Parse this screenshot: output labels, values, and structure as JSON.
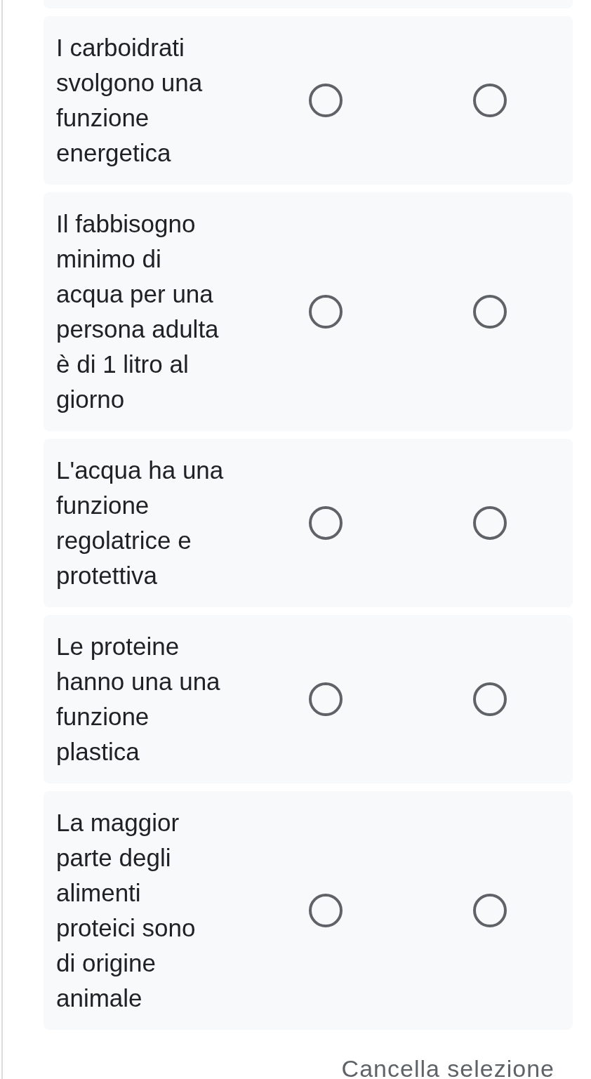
{
  "statements": [
    {
      "text": "I carboidrati\nsvolgono una\nfunzione\nenergetica",
      "choices": [
        {
          "selected": false
        },
        {
          "selected": false
        }
      ]
    },
    {
      "text": "Il fabbisogno\nminimo di\nacqua per una\npersona adulta\nè di 1 litro al\ngiorno",
      "choices": [
        {
          "selected": false
        },
        {
          "selected": false
        }
      ]
    },
    {
      "text": "L'acqua ha una\nfunzione\nregolatrice e\nprotettiva",
      "choices": [
        {
          "selected": false
        },
        {
          "selected": false
        }
      ]
    },
    {
      "text": "Le proteine\nhanno una una\nfunzione\nplastica",
      "choices": [
        {
          "selected": false
        },
        {
          "selected": false
        }
      ]
    },
    {
      "text": "La maggior\nparte degli\nalimenti\nproteici sono\ndi origine\nanimale",
      "choices": [
        {
          "selected": false
        },
        {
          "selected": false
        }
      ]
    }
  ],
  "clear_button": {
    "label": "Cancella selezione"
  }
}
